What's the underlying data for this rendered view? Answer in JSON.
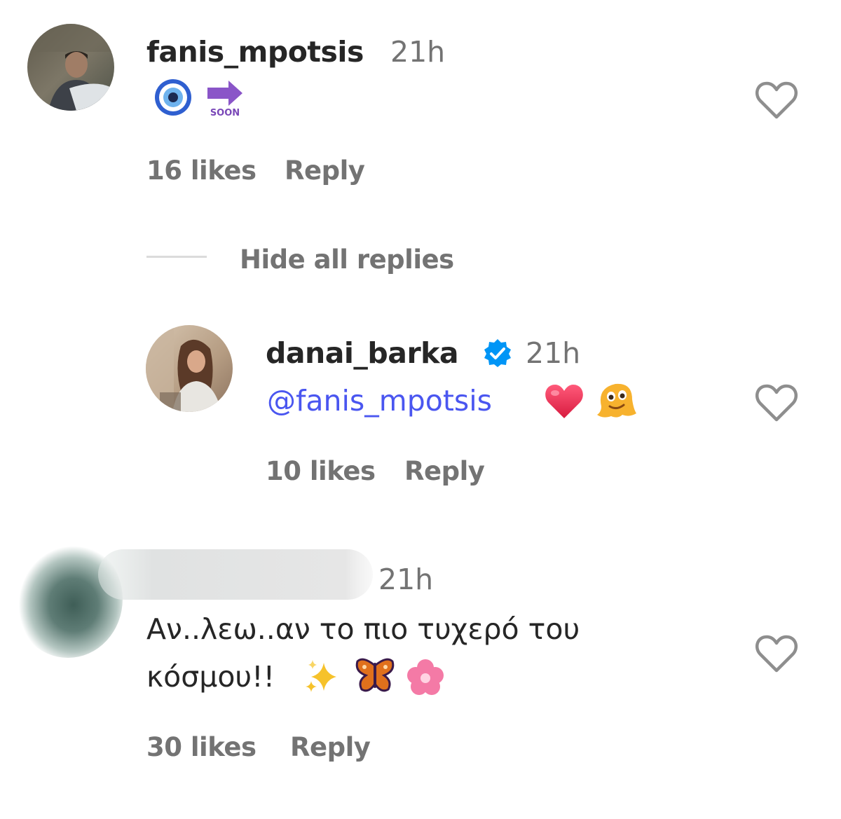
{
  "comments": [
    {
      "username": "fanis_mpotsis",
      "time": "21h",
      "likes": "16 likes",
      "reply": "Reply",
      "emojis": [
        "nazar-amulet-icon",
        "soon-arrow-icon"
      ],
      "soon_text": "SOON"
    },
    {
      "username": "danai_barka",
      "verified": true,
      "time": "21h",
      "mention": "@fanis_mpotsis",
      "emojis": [
        "red-heart-icon",
        "melting-face-icon"
      ],
      "likes": "10 likes",
      "reply": "Reply"
    },
    {
      "username_blurred": true,
      "time": "21h",
      "text_line1": "Αν..λεω..αν το πιο τυχερό του",
      "text_line2": "κόσμου!!",
      "emojis": [
        "sparkles-icon",
        "butterfly-icon",
        "cherry-blossom-icon"
      ],
      "likes": "30 likes",
      "reply": "Reply"
    }
  ],
  "thread": {
    "hide_replies": "Hide all replies"
  },
  "colors": {
    "text": "#262626",
    "secondary": "#737373",
    "mention": "#4a56f0",
    "verified": "#0095f6"
  }
}
